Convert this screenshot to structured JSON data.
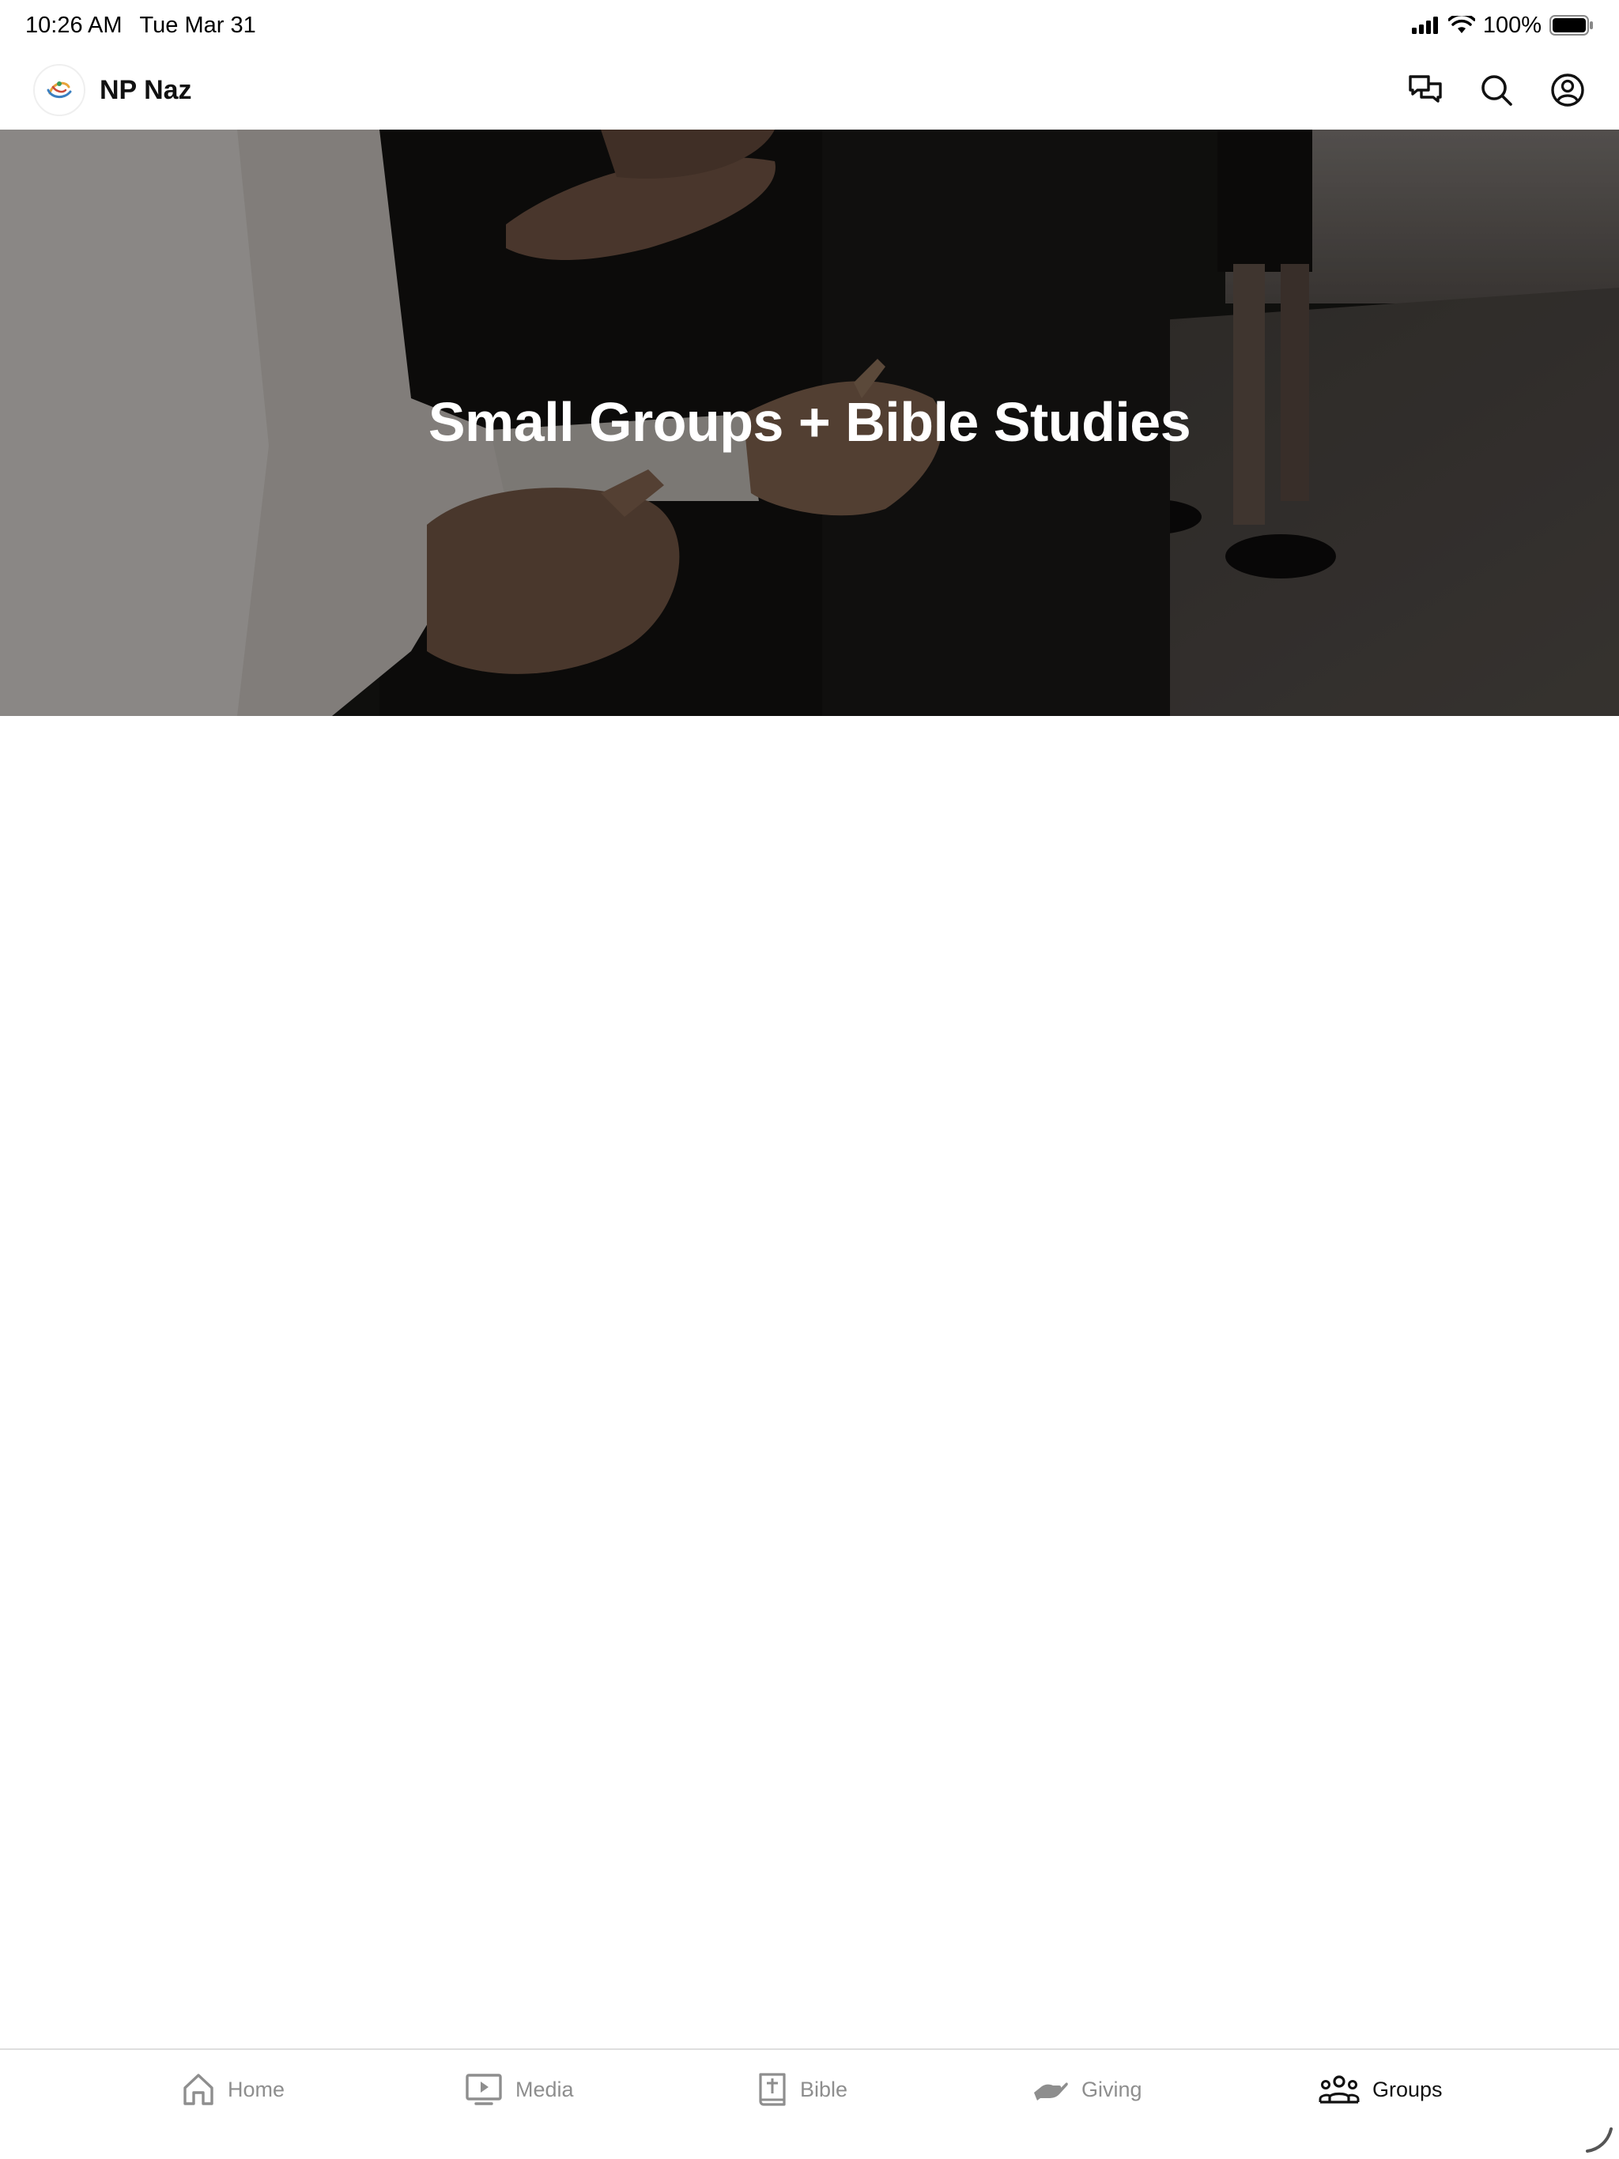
{
  "status_bar": {
    "time": "10:26 AM",
    "date": "Tue Mar 31",
    "battery": "100%"
  },
  "header": {
    "app_name": "NP Naz",
    "actions": [
      {
        "name": "chat",
        "icon": "chat-bubbles-icon"
      },
      {
        "name": "search",
        "icon": "search-icon"
      },
      {
        "name": "profile",
        "icon": "account-circle-icon"
      }
    ]
  },
  "hero": {
    "title": "Small Groups + Bible Studies"
  },
  "tabs": [
    {
      "label": "Home",
      "icon": "home-icon",
      "active": false
    },
    {
      "label": "Media",
      "icon": "tv-play-icon",
      "active": false
    },
    {
      "label": "Bible",
      "icon": "bible-book-icon",
      "active": false
    },
    {
      "label": "Giving",
      "icon": "giving-hand-icon",
      "active": false
    },
    {
      "label": "Groups",
      "icon": "groups-people-icon",
      "active": true
    }
  ],
  "colors": {
    "tab_active": "#111111",
    "tab_inactive": "#8e8e8e",
    "hero_text": "#ffffff"
  }
}
